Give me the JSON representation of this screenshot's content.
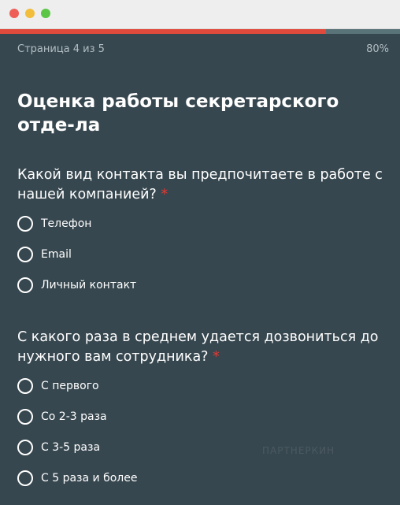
{
  "progress": {
    "page_label": "Страница 4 из 5",
    "percent_label": "80%",
    "fraction": 0.815
  },
  "form": {
    "title": "Оценка работы секретарского отде-ла"
  },
  "questions": [
    {
      "text": "Какой вид контакта вы предпочитаете в работе с нашей компанией?",
      "required_mark": "*",
      "options": [
        "Телефон",
        "Email",
        "Личный контакт"
      ]
    },
    {
      "text": "С какого раза в среднем удается дозвониться до нужного вам сотрудника?",
      "required_mark": "*",
      "options": [
        "С первого",
        "Со 2-3 раза",
        "С 3-5 раза",
        "С 5 раза и более"
      ]
    }
  ],
  "watermark": "ПАРТНЕРКИН",
  "colors": {
    "accent": "#e04a3d",
    "background": "#37474f",
    "required": "#e53935"
  }
}
